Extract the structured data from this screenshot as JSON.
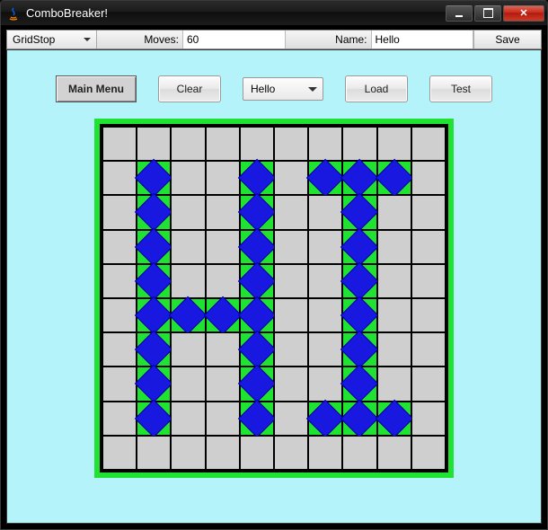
{
  "window": {
    "title": "ComboBreaker!"
  },
  "toolbar": {
    "mode_value": "GridStop",
    "moves_label": "Moves:",
    "moves_value": "60",
    "name_label": "Name:",
    "name_value": "Hello",
    "save_label": "Save"
  },
  "controls": {
    "main_menu": "Main Menu",
    "clear": "Clear",
    "select_value": "Hello",
    "load": "Load",
    "test": "Test"
  },
  "grid": {
    "rows": 10,
    "cols": 10,
    "cells": [
      [
        0,
        0,
        0,
        0,
        0,
        0,
        0,
        0,
        0,
        0
      ],
      [
        0,
        1,
        0,
        0,
        1,
        0,
        1,
        1,
        1,
        0
      ],
      [
        0,
        1,
        0,
        0,
        1,
        0,
        0,
        1,
        0,
        0
      ],
      [
        0,
        1,
        0,
        0,
        1,
        0,
        0,
        1,
        0,
        0
      ],
      [
        0,
        1,
        0,
        0,
        1,
        0,
        0,
        1,
        0,
        0
      ],
      [
        0,
        1,
        1,
        1,
        1,
        0,
        0,
        1,
        0,
        0
      ],
      [
        0,
        1,
        0,
        0,
        1,
        0,
        0,
        1,
        0,
        0
      ],
      [
        0,
        1,
        0,
        0,
        1,
        0,
        0,
        1,
        0,
        0
      ],
      [
        0,
        1,
        0,
        0,
        1,
        0,
        1,
        1,
        1,
        0
      ],
      [
        0,
        0,
        0,
        0,
        0,
        0,
        0,
        0,
        0,
        0
      ]
    ]
  }
}
